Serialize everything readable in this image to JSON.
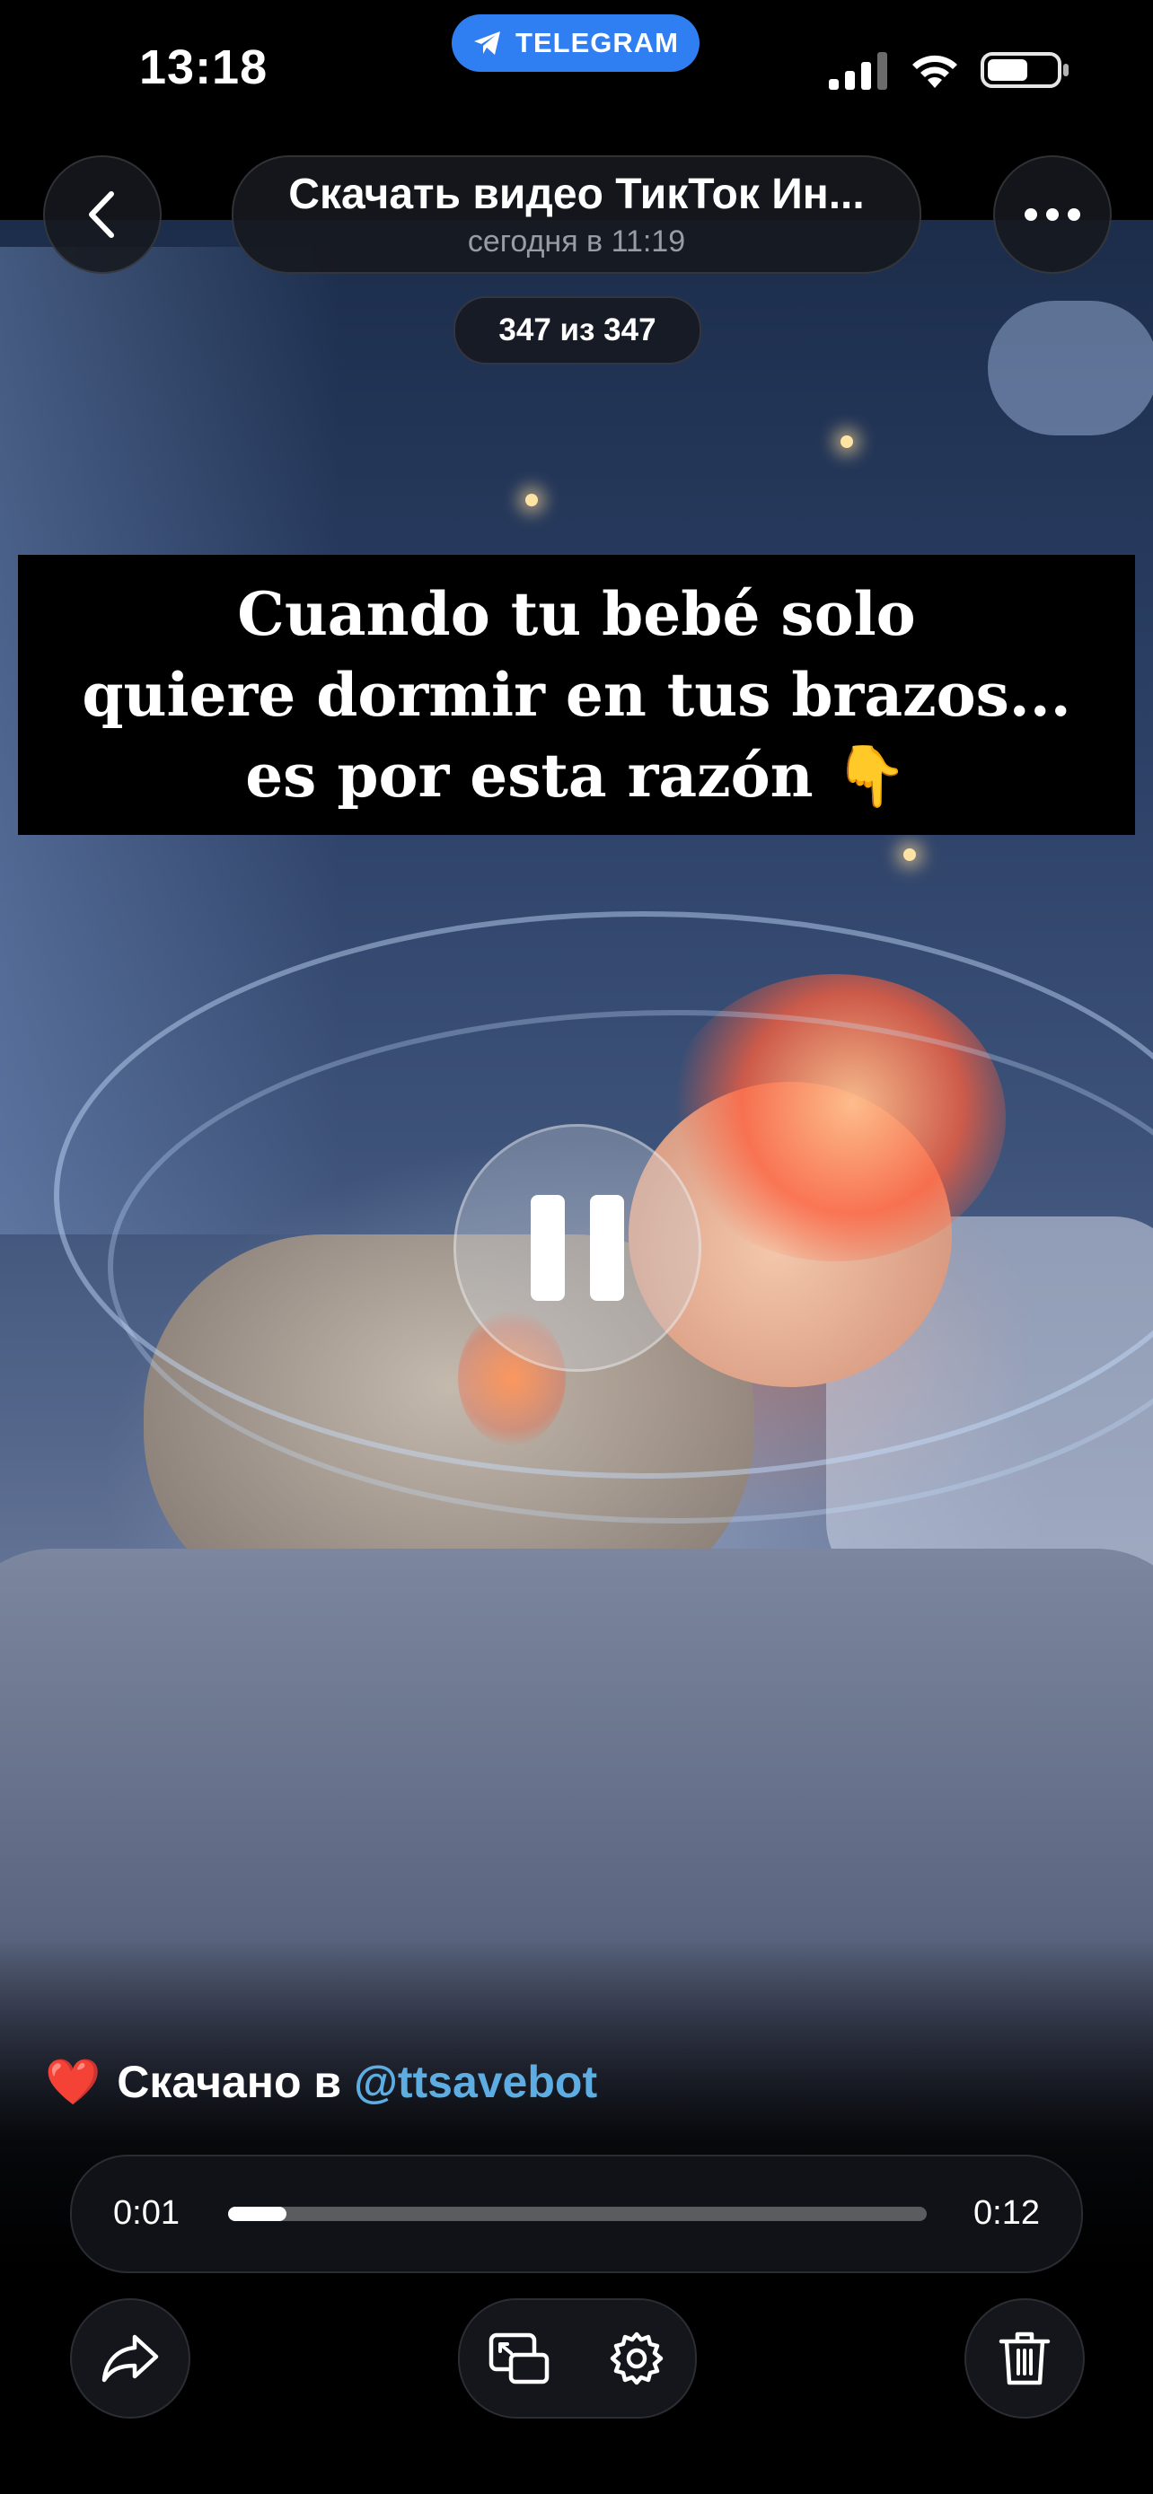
{
  "status_bar": {
    "time": "13:18",
    "app_pill": "TELEGRAM",
    "icons": [
      "signal-icon",
      "wifi-icon",
      "battery-icon"
    ]
  },
  "header": {
    "title": "Скачать видео ТикТок Ин...",
    "subtitle": "сегодня в 11:19",
    "counter": "347 из 347",
    "back_icon": "chevron-left-icon",
    "more_icon": "more-horizontal-icon"
  },
  "video": {
    "overlay_caption_lines": [
      "Cuando tu bebé solo",
      "quiere dormir en tus brazos...",
      "es por esta razón 👇"
    ],
    "playback_state": "playing",
    "control_icon": "pause-icon"
  },
  "credit": {
    "emoji": "❤️",
    "text": "Скачано в",
    "handle": "@ttsavebot"
  },
  "player": {
    "current_time": "0:01",
    "total_time": "0:12",
    "progress": 0.083
  },
  "toolbar": {
    "icons": [
      "share-icon",
      "picture-in-picture-icon",
      "settings-gear-icon",
      "trash-icon"
    ]
  },
  "colors": {
    "telegram_blue": "#2f7ff2",
    "link_blue": "#5dade2",
    "heart_red": "#e8333f",
    "control_bg": "#15161b"
  }
}
